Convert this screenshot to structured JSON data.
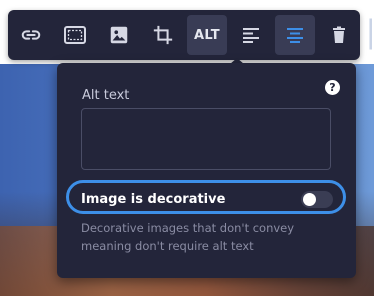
{
  "toolbar": {
    "buttons": [
      {
        "icon": "link-icon",
        "label": ""
      },
      {
        "icon": "frame-icon",
        "label": ""
      },
      {
        "icon": "image-icon",
        "label": ""
      },
      {
        "icon": "crop-icon",
        "label": ""
      },
      {
        "icon": "alt-text-icon",
        "label": "ALT",
        "active": true
      },
      {
        "icon": "align-left-icon",
        "label": ""
      },
      {
        "icon": "align-center-icon",
        "label": "",
        "selected": true
      },
      {
        "icon": "trash-icon",
        "label": ""
      }
    ],
    "accent_color": "#3d8fe8"
  },
  "popover": {
    "help_label": "?",
    "alt_text_label": "Alt text",
    "alt_text_value": "",
    "decorative_label": "Image is decorative",
    "decorative_on": false,
    "decorative_help": "Decorative images that don't convey meaning don't require alt text"
  }
}
